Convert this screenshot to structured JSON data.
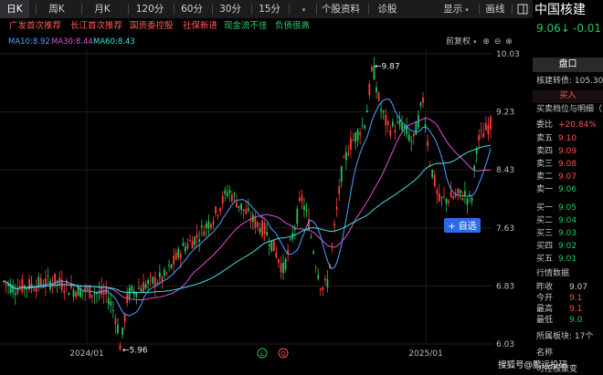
{
  "toolbar": {
    "periods": [
      "日K",
      "周K",
      "月K",
      "120分",
      "60分",
      "30分",
      "15分"
    ],
    "more_caret": "▾",
    "stock_info": "个股资料",
    "diagnose": "诊股",
    "display": "显示",
    "draw": "画线"
  },
  "tags": [
    {
      "text": "广发首次推荐",
      "color": "#ff5a5a"
    },
    {
      "text": "长江首次推荐",
      "color": "#ff5a5a"
    },
    {
      "text": "国资委控股",
      "color": "#ff5a5a"
    },
    {
      "text": "社保新进",
      "color": "#ff5a5a"
    },
    {
      "text": "现金流不佳",
      "color": "#2ecc71"
    },
    {
      "text": "负债很高",
      "color": "#2ecc71"
    }
  ],
  "ma_legend": [
    {
      "text": "MA10:8.92",
      "color": "#4fa3ff"
    },
    {
      "text": "MA30:8.44",
      "color": "#e04fd8"
    },
    {
      "text": "MA60:8.43",
      "color": "#3ee0e0"
    }
  ],
  "chart_tools": {
    "restore": "前复权",
    "plus": "⊕",
    "minus": "⊖",
    "close": "⊗"
  },
  "colors": {
    "up": "#ff3b3b",
    "down": "#22c55e",
    "background": "#000000"
  },
  "chart_data": {
    "type": "candlestick",
    "y_ticks": [
      "10.03",
      "9.23",
      "8.43",
      "7.63",
      "6.83",
      "6.03"
    ],
    "x_ticks": [
      "2024/01",
      "2025/01"
    ],
    "ylim": [
      6.03,
      10.03
    ],
    "annotations": {
      "max": "←9.87",
      "min": "←5.96"
    },
    "add_button": "+ 自选",
    "markers": [
      "L",
      "Q"
    ],
    "ma_lines": [
      {
        "name": "MA10",
        "color": "#4fa3ff"
      },
      {
        "name": "MA30",
        "color": "#e04fd8"
      },
      {
        "name": "MA60",
        "color": "#3ee0e0"
      }
    ]
  },
  "panel": {
    "name": "中国核建",
    "price": "9.06↓",
    "change": "-0.01",
    "tab": "盘口",
    "convertible": "核建转债: 105.30",
    "buy_in": "买入",
    "book_title": "买卖档位与明细（",
    "weibi_label": "委比",
    "weibi_value": "+20.84%",
    "asks": [
      {
        "label": "卖五",
        "price": "9.10",
        "dir": "up"
      },
      {
        "label": "卖四",
        "price": "9.09",
        "dir": "up"
      },
      {
        "label": "卖三",
        "price": "9.08",
        "dir": "up"
      },
      {
        "label": "卖二",
        "price": "9.07",
        "dir": "up"
      },
      {
        "label": "卖一",
        "price": "9.06",
        "dir": "dn"
      }
    ],
    "bids": [
      {
        "label": "买一",
        "price": "9.05",
        "dir": "dn"
      },
      {
        "label": "买二",
        "price": "9.04",
        "dir": "dn"
      },
      {
        "label": "买三",
        "price": "9.03",
        "dir": "dn"
      },
      {
        "label": "买四",
        "price": "9.02",
        "dir": "dn"
      },
      {
        "label": "买五",
        "price": "9.01",
        "dir": "dn"
      }
    ],
    "quote_title": "行情数据",
    "quote": [
      {
        "label": "昨收",
        "value": "9.07",
        "dir": "neutral"
      },
      {
        "label": "今开",
        "value": "9.1",
        "dir": "up"
      },
      {
        "label": "最高",
        "value": "9.1",
        "dir": "up"
      },
      {
        "label": "最低",
        "value": "9.0",
        "dir": "dn"
      }
    ],
    "sector": "所属板块: 17个",
    "name_label": "名称",
    "watermark": "搜狐号@鹏远投研",
    "bottom_cut": "可控核聚变"
  }
}
